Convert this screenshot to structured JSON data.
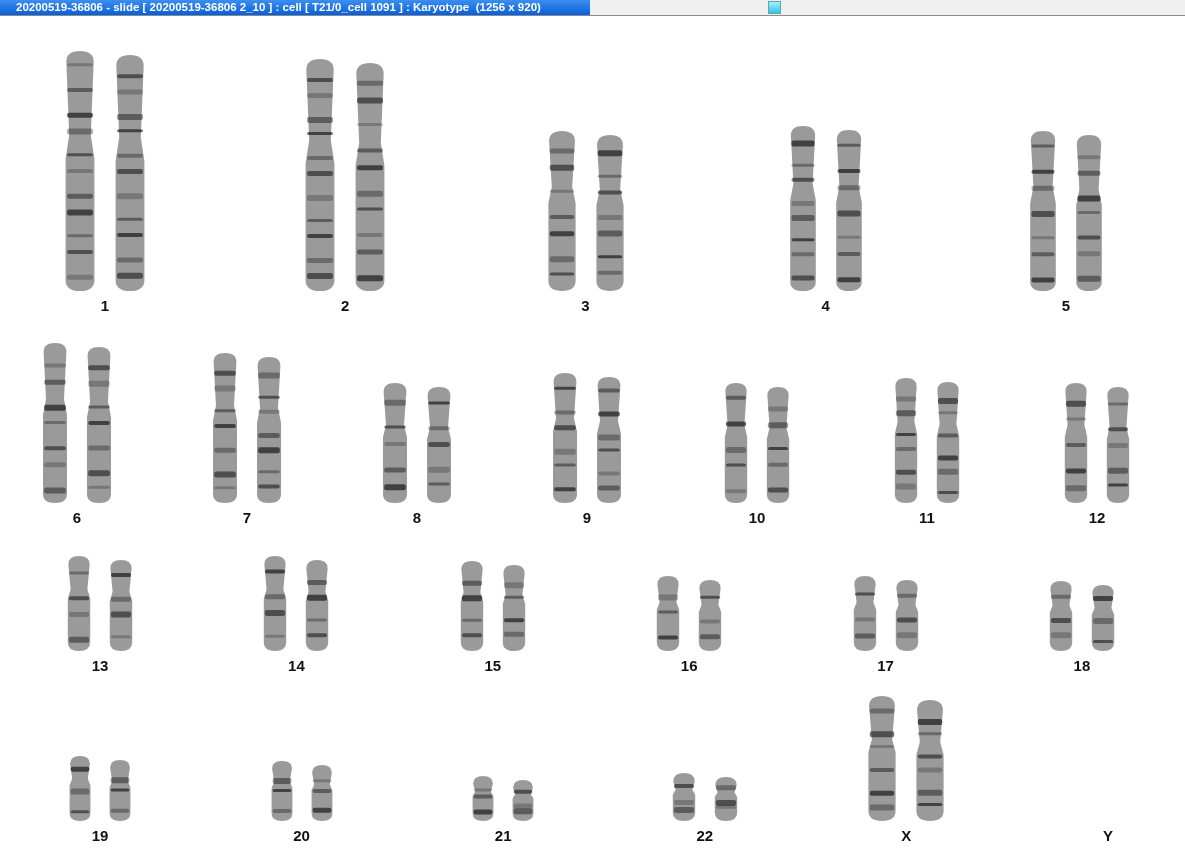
{
  "window": {
    "title": "20200519-36806 - slide [ 20200519-36806 2_10 ] : cell [ T21/0_cell 1091 ] : Karyotype  (1256 x 920)"
  },
  "karyotype": {
    "rows": [
      {
        "pairs": [
          {
            "label": "1",
            "chromosomes": [
              {
                "kind": "chromosome"
              },
              {
                "kind": "chromosome"
              }
            ]
          },
          {
            "label": "2",
            "chromosomes": [
              {
                "kind": "chromosome"
              },
              {
                "kind": "chromosome"
              }
            ]
          },
          {
            "label": "3",
            "chromosomes": [
              {
                "kind": "chromosome"
              },
              {
                "kind": "chromosome"
              }
            ]
          },
          {
            "label": "4",
            "chromosomes": [
              {
                "kind": "chromosome"
              },
              {
                "kind": "chromosome"
              }
            ]
          },
          {
            "label": "5",
            "chromosomes": [
              {
                "kind": "chromosome"
              },
              {
                "kind": "chromosome"
              }
            ]
          }
        ]
      },
      {
        "pairs": [
          {
            "label": "6",
            "chromosomes": [
              {
                "kind": "chromosome"
              },
              {
                "kind": "chromosome"
              }
            ]
          },
          {
            "label": "7",
            "chromosomes": [
              {
                "kind": "chromosome"
              },
              {
                "kind": "chromosome"
              }
            ]
          },
          {
            "label": "8",
            "chromosomes": [
              {
                "kind": "chromosome"
              },
              {
                "kind": "chromosome"
              }
            ]
          },
          {
            "label": "9",
            "chromosomes": [
              {
                "kind": "chromosome"
              },
              {
                "kind": "chromosome"
              }
            ]
          },
          {
            "label": "10",
            "chromosomes": [
              {
                "kind": "chromosome"
              },
              {
                "kind": "chromosome"
              }
            ]
          },
          {
            "label": "11",
            "chromosomes": [
              {
                "kind": "chromosome"
              },
              {
                "kind": "chromosome"
              }
            ]
          },
          {
            "label": "12",
            "chromosomes": [
              {
                "kind": "chromosome"
              },
              {
                "kind": "chromosome"
              }
            ]
          }
        ]
      },
      {
        "pairs": [
          {
            "label": "13",
            "chromosomes": [
              {
                "kind": "chromosome"
              },
              {
                "kind": "chromosome"
              }
            ]
          },
          {
            "label": "14",
            "chromosomes": [
              {
                "kind": "chromosome"
              },
              {
                "kind": "chromosome"
              }
            ]
          },
          {
            "label": "15",
            "chromosomes": [
              {
                "kind": "chromosome"
              },
              {
                "kind": "chromosome"
              }
            ]
          },
          {
            "label": "16",
            "chromosomes": [
              {
                "kind": "chromosome"
              },
              {
                "kind": "chromosome"
              }
            ]
          },
          {
            "label": "17",
            "chromosomes": [
              {
                "kind": "chromosome"
              },
              {
                "kind": "chromosome"
              }
            ]
          },
          {
            "label": "18",
            "chromosomes": [
              {
                "kind": "chromosome"
              },
              {
                "kind": "chromosome"
              }
            ]
          }
        ]
      },
      {
        "pairs": [
          {
            "label": "19",
            "chromosomes": [
              {
                "kind": "chromosome"
              },
              {
                "kind": "chromosome"
              }
            ]
          },
          {
            "label": "20",
            "chromosomes": [
              {
                "kind": "chromosome"
              },
              {
                "kind": "chromosome"
              }
            ]
          },
          {
            "label": "21",
            "chromosomes": [
              {
                "kind": "chromosome"
              },
              {
                "kind": "chromosome"
              }
            ]
          },
          {
            "label": "22",
            "chromosomes": [
              {
                "kind": "chromosome"
              },
              {
                "kind": "chromosome"
              }
            ]
          },
          {
            "label": "X",
            "chromosomes": [
              {
                "kind": "chromosome"
              },
              {
                "kind": "chromosome"
              }
            ]
          },
          {
            "label": "Y"
          }
        ]
      }
    ]
  }
}
